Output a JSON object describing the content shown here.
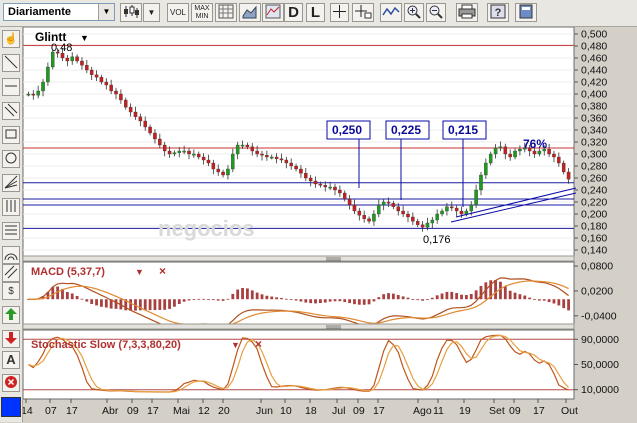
{
  "toolbar": {
    "period_select": "Diariamente",
    "vol_label": "VOL",
    "maxmin_label_1": "MAX",
    "maxmin_label_2": "MIN",
    "d_label": "D",
    "l_label": "L"
  },
  "chart_data": [
    {
      "type": "candlestick",
      "title": "Glintt",
      "watermark": "negocios",
      "y_ticks": [
        "0,500",
        "0,480",
        "0,460",
        "0,440",
        "0,420",
        "0,400",
        "0,380",
        "0,360",
        "0,340",
        "0,320",
        "0,300",
        "0,280",
        "0,260",
        "0,240",
        "0,220",
        "0,200",
        "0,180",
        "0,160",
        "0,140"
      ],
      "ylim": [
        0.135,
        0.505
      ],
      "close_series": [
        0.4,
        0.398,
        0.405,
        0.42,
        0.445,
        0.47,
        0.468,
        0.46,
        0.455,
        0.462,
        0.455,
        0.448,
        0.44,
        0.432,
        0.428,
        0.42,
        0.415,
        0.405,
        0.4,
        0.39,
        0.378,
        0.37,
        0.362,
        0.355,
        0.345,
        0.335,
        0.325,
        0.315,
        0.305,
        0.3,
        0.302,
        0.305,
        0.305,
        0.3,
        0.3,
        0.295,
        0.29,
        0.285,
        0.275,
        0.27,
        0.265,
        0.275,
        0.3,
        0.315,
        0.315,
        0.312,
        0.305,
        0.3,
        0.298,
        0.295,
        0.295,
        0.292,
        0.29,
        0.285,
        0.28,
        0.275,
        0.268,
        0.26,
        0.255,
        0.25,
        0.248,
        0.245,
        0.245,
        0.24,
        0.235,
        0.225,
        0.215,
        0.205,
        0.198,
        0.192,
        0.188,
        0.2,
        0.215,
        0.22,
        0.218,
        0.212,
        0.205,
        0.2,
        0.195,
        0.188,
        0.182,
        0.178,
        0.185,
        0.19,
        0.2,
        0.205,
        0.212,
        0.21,
        0.205,
        0.2,
        0.205,
        0.215,
        0.24,
        0.265,
        0.285,
        0.3,
        0.31,
        0.312,
        0.3,
        0.295,
        0.305,
        0.308,
        0.31,
        0.305,
        0.3,
        0.305,
        0.308,
        0.3,
        0.295,
        0.285,
        0.27,
        0.258
      ],
      "annotations": {
        "high_label": "0,48",
        "low_label": "0,176",
        "box_1": "0,250",
        "box_2": "0,225",
        "box_3": "0,215",
        "percent": "76%"
      },
      "hlines_red": [
        0.481,
        0.31
      ],
      "hlines_blue": [
        0.252,
        0.225,
        0.215,
        0.176
      ]
    },
    {
      "type": "line",
      "title": "MACD (5,37,7)",
      "close_symbol": "×",
      "y_ticks": [
        "0,0800",
        "0,0200",
        "-0,0400"
      ],
      "ylim": [
        -0.055,
        0.085
      ]
    },
    {
      "type": "line",
      "title": "Stochastic Slow (7,3,3,80,20)",
      "close_symbol": "×",
      "y_ticks": [
        "90,0000",
        "50,0000",
        "10,0000"
      ],
      "ylim": [
        0,
        100
      ]
    }
  ],
  "x_ticks": [
    "14",
    "07",
    "17",
    "Abr",
    "09",
    "17",
    "Mai",
    "12",
    "20",
    "Jun",
    "10",
    "18",
    "Jul",
    "09",
    "17",
    "Ago",
    "11",
    "19",
    "Set",
    "09",
    "17",
    "Out"
  ]
}
